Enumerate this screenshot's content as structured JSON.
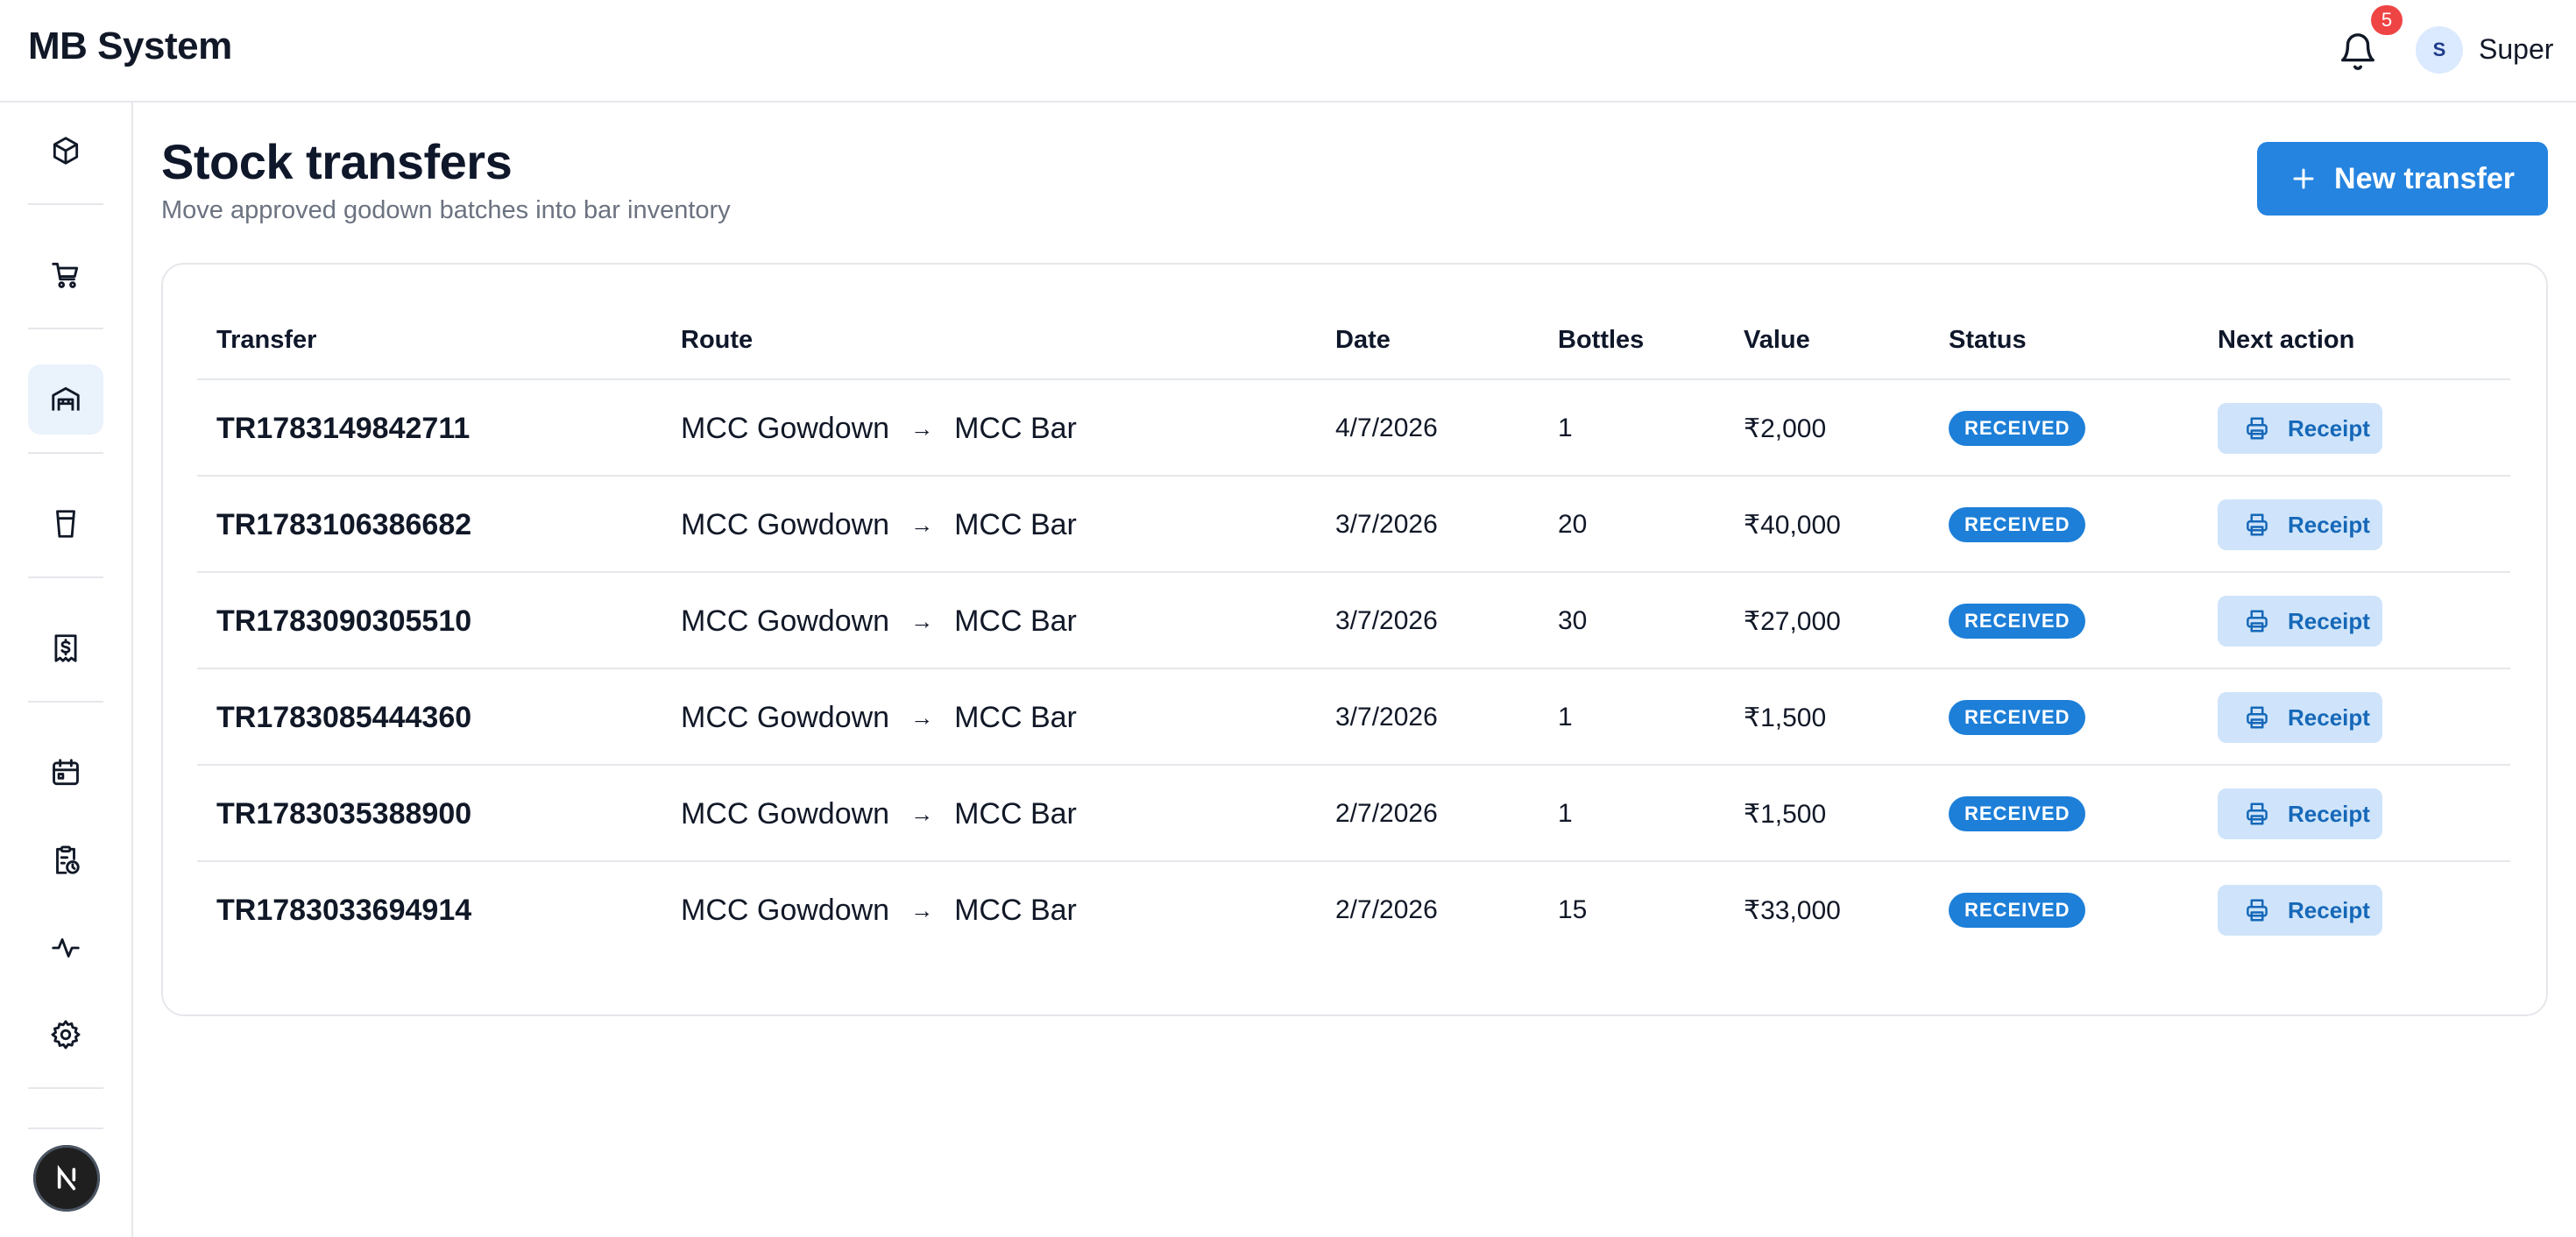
{
  "app": {
    "title": "MB System"
  },
  "header": {
    "notification_count": "5",
    "user_initial": "S",
    "user_name": "Super"
  },
  "sidebar": {
    "items": [
      {
        "name": "products",
        "icon": "box-icon"
      },
      {
        "name": "purchases",
        "icon": "cart-icon"
      },
      {
        "name": "godown",
        "icon": "warehouse-icon",
        "active": true
      },
      {
        "name": "bar",
        "icon": "cup-icon"
      },
      {
        "name": "billing",
        "icon": "receipt-icon"
      },
      {
        "name": "calendar",
        "icon": "calendar-icon"
      },
      {
        "name": "reports",
        "icon": "clipboard-clock-icon"
      },
      {
        "name": "activity",
        "icon": "activity-icon"
      },
      {
        "name": "settings",
        "icon": "gear-icon"
      }
    ],
    "footer_logo": "N"
  },
  "page": {
    "title": "Stock transfers",
    "subtitle": "Move approved godown batches into bar inventory",
    "new_button_label": "New transfer"
  },
  "table": {
    "columns": [
      "Transfer",
      "Route",
      "Date",
      "Bottles",
      "Value",
      "Status",
      "Next action"
    ],
    "rows": [
      {
        "id": "TR1783149842711",
        "from": "MCC Gowdown",
        "to": "MCC Bar",
        "date": "4/7/2026",
        "bottles": "1",
        "value": "₹2,000",
        "status": "RECEIVED",
        "action": "Receipt"
      },
      {
        "id": "TR1783106386682",
        "from": "MCC Gowdown",
        "to": "MCC Bar",
        "date": "3/7/2026",
        "bottles": "20",
        "value": "₹40,000",
        "status": "RECEIVED",
        "action": "Receipt"
      },
      {
        "id": "TR1783090305510",
        "from": "MCC Gowdown",
        "to": "MCC Bar",
        "date": "3/7/2026",
        "bottles": "30",
        "value": "₹27,000",
        "status": "RECEIVED",
        "action": "Receipt"
      },
      {
        "id": "TR1783085444360",
        "from": "MCC Gowdown",
        "to": "MCC Bar",
        "date": "3/7/2026",
        "bottles": "1",
        "value": "₹1,500",
        "status": "RECEIVED",
        "action": "Receipt"
      },
      {
        "id": "TR1783035388900",
        "from": "MCC Gowdown",
        "to": "MCC Bar",
        "date": "2/7/2026",
        "bottles": "1",
        "value": "₹1,500",
        "status": "RECEIVED",
        "action": "Receipt"
      },
      {
        "id": "TR1783033694914",
        "from": "MCC Gowdown",
        "to": "MCC Bar",
        "date": "2/7/2026",
        "bottles": "15",
        "value": "₹33,000",
        "status": "RECEIVED",
        "action": "Receipt"
      }
    ]
  },
  "colors": {
    "accent": "#2584e0",
    "badge": "#1d7fd8",
    "receipt_bg": "#cfe4fa",
    "notification": "#ef4444"
  }
}
